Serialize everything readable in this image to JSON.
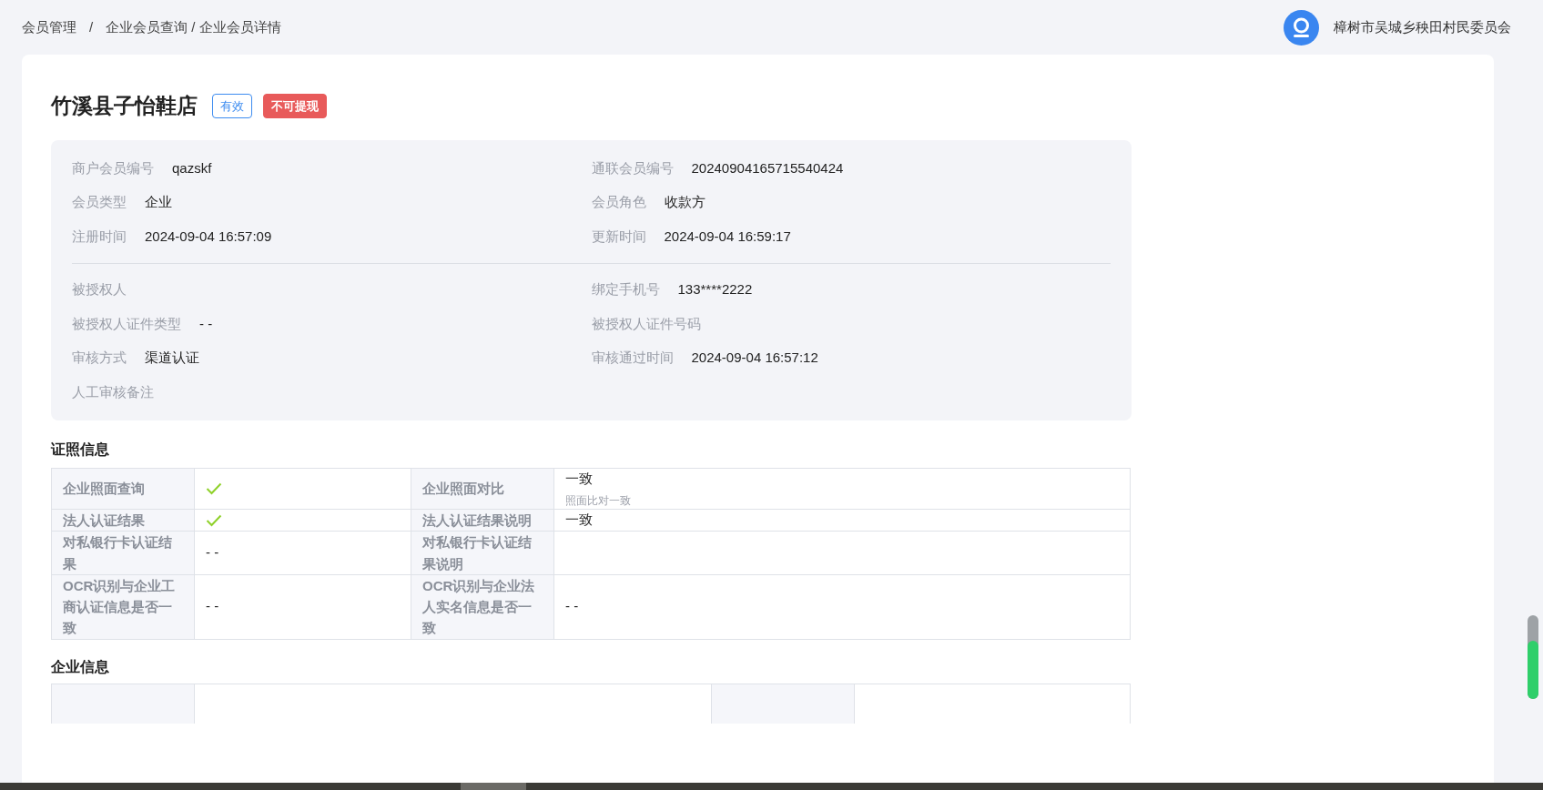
{
  "breadcrumb": [
    {
      "label": "会员管理"
    },
    {
      "label": "/"
    },
    {
      "label": "企业会员查询 / 企业会员详情"
    }
  ],
  "user": {
    "name": "樟树市吴城乡秧田村民委员会"
  },
  "member": {
    "name": "竹溪县子怡鞋店",
    "tags": [
      {
        "label": "有效",
        "kind": "outline"
      },
      {
        "label": "不可提现",
        "kind": "solid"
      }
    ]
  },
  "info_groups": [
    {
      "fields": [
        {
          "label": "商户会员编号",
          "value": "qazskf"
        },
        {
          "label": "通联会员编号",
          "value": "20240904165715540424"
        },
        {
          "label": "会员类型",
          "value": "企业"
        },
        {
          "label": "会员角色",
          "value": "收款方"
        },
        {
          "label": "注册时间",
          "value": "2024-09-04 16:57:09"
        },
        {
          "label": "更新时间",
          "value": "2024-09-04 16:59:17"
        }
      ]
    },
    {
      "fields": [
        {
          "label": "被授权人"
        },
        {
          "label": "绑定手机号",
          "value": "133****2222"
        },
        {
          "label": "被授权人证件类型",
          "value": "- -"
        },
        {
          "label": "被授权人证件号码"
        },
        {
          "label": "审核方式",
          "value": "渠道认证"
        },
        {
          "label": "审核通过时间",
          "value": "2024-09-04 16:57:12"
        },
        {
          "label": "人工审核备注"
        }
      ]
    }
  ],
  "license_section": {
    "title": "证照信息",
    "rows": [
      {
        "cells": [
          {
            "label": "企业照面查询",
            "kind": "check",
            "checked": true
          },
          {
            "label": "企业照面对比",
            "kind": "text",
            "value": "一致",
            "note": "照面比对一致"
          }
        ]
      },
      {
        "cells": [
          {
            "label": "法人认证结果",
            "kind": "check",
            "checked": true
          },
          {
            "label": "法人认证结果说明",
            "kind": "text",
            "value": "一致"
          }
        ]
      },
      {
        "cells": [
          {
            "label": "对私银行卡认证结果",
            "kind": "text",
            "value": "- -"
          },
          {
            "label": "对私银行卡认证结果说明",
            "kind": "text"
          }
        ]
      },
      {
        "cells": [
          {
            "label": "OCR识别与企业工商认证信息是否一致",
            "kind": "text",
            "value": "- -"
          },
          {
            "label": "OCR识别与企业法人实名信息是否一致",
            "kind": "text",
            "value": "- -"
          }
        ]
      }
    ]
  },
  "company_section": {
    "title": "企业信息"
  }
}
